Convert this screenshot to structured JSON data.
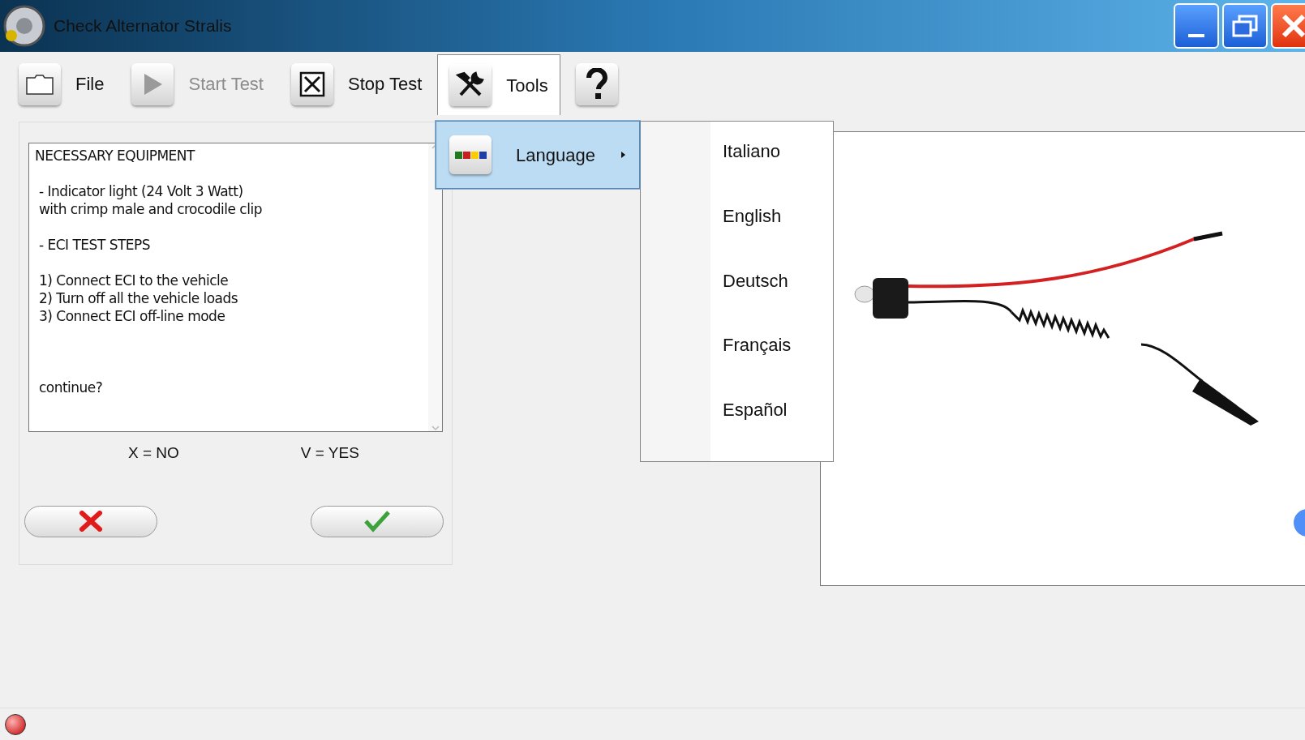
{
  "window": {
    "title": "Check Alternator Stralis"
  },
  "toolbar": [
    {
      "kind": "file",
      "label": "File",
      "disabled": false,
      "selected": false
    },
    {
      "kind": "start",
      "label": "Start Test",
      "disabled": true,
      "selected": false
    },
    {
      "kind": "stop",
      "label": "Stop Test",
      "disabled": false,
      "selected": false
    },
    {
      "kind": "tools",
      "label": "Tools",
      "disabled": false,
      "selected": true
    },
    {
      "kind": "help",
      "selected": false
    }
  ],
  "tools_menu": {
    "items": [
      {
        "label": "Language",
        "selected": true
      }
    ]
  },
  "language_menu": {
    "items": [
      {
        "label": "Italiano"
      },
      {
        "label": "English"
      },
      {
        "label": "Deutsch"
      },
      {
        "label": "Français"
      },
      {
        "label": "Español"
      }
    ]
  },
  "message": {
    "paragraphs": [
      [
        "NECESSARY EQUIPMENT"
      ],
      [
        " - Indicator light (24 Volt 3 Watt)",
        " with crimp male and crocodile clip"
      ],
      [
        " - ECI TEST STEPS"
      ],
      [
        " 1) Connect ECI to the vehicle",
        " 2) Turn off all the vehicle loads",
        " 3) Connect ECI off-line mode"
      ],
      [
        " continue?"
      ]
    ]
  },
  "hints": [
    "X = NO",
    "V = YES"
  ],
  "buttons": [
    {
      "kind": "no"
    },
    {
      "kind": "yes"
    }
  ],
  "status_bar": {
    "connected": false
  }
}
